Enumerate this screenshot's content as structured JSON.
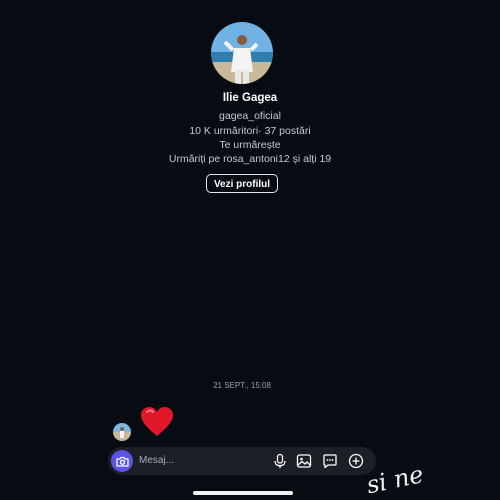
{
  "profile": {
    "name": "Ilie Gagea",
    "username": "gagea_oficial",
    "stats": "10 K urmăritori· 37 postări",
    "follows_you": "Te urmărește",
    "mutuals": "Urmăriți pe rosa_antoni12 și alți 19",
    "view_profile_label": "Vezi profilul"
  },
  "chat": {
    "timestamp": "21 SEPT., 15:08",
    "message_emoji": "heart"
  },
  "composer": {
    "placeholder": "Mesaj..."
  },
  "overlay": {
    "script_text": "si ne"
  },
  "icons": {
    "camera": "camera-icon",
    "mic": "microphone-icon",
    "gallery": "image-icon",
    "sticker": "chat-bubble-icon",
    "add": "plus-circle-icon"
  },
  "colors": {
    "background": "#070b12",
    "camera_button": "#5b52e8",
    "heart": "#e0182a",
    "composer": "#1c1f26"
  }
}
